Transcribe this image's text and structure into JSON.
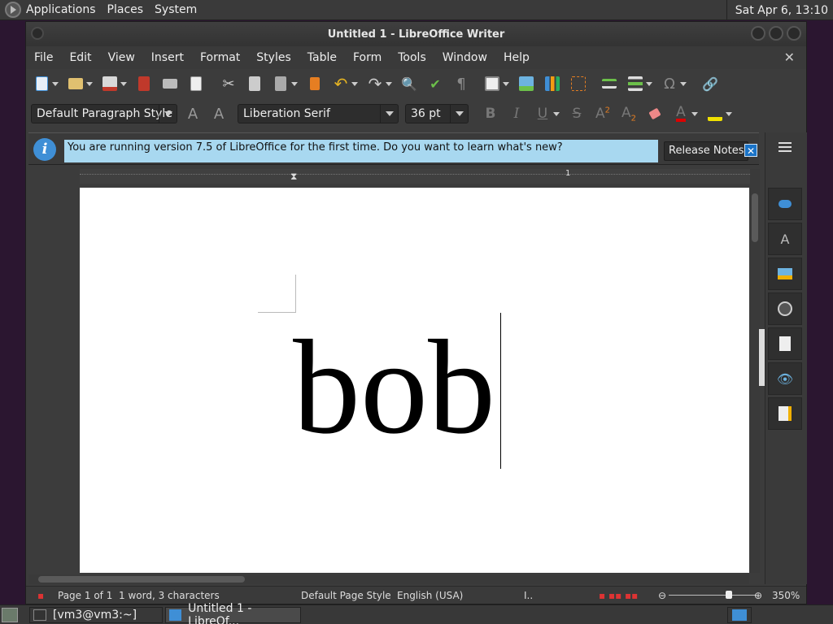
{
  "top_panel": {
    "menus": [
      "Applications",
      "Places",
      "System"
    ],
    "clock": "Sat Apr  6, 13:10"
  },
  "window": {
    "title": "Untitled 1 - LibreOffice Writer",
    "menubar": [
      "File",
      "Edit",
      "View",
      "Insert",
      "Format",
      "Styles",
      "Table",
      "Form",
      "Tools",
      "Window",
      "Help"
    ]
  },
  "format_bar": {
    "paragraph_style": "Default Paragraph Style",
    "font_name": "Liberation Serif",
    "font_size": "36 pt"
  },
  "infobar": {
    "message": "You are running version 7.5 of LibreOffice for the first time. Do you want to learn what's new?",
    "release_notes_label": "Release Notes"
  },
  "ruler": {
    "mark": "1"
  },
  "document": {
    "text": "bob"
  },
  "statusbar": {
    "page": "Page 1 of 1",
    "words": "1 word, 3 characters",
    "page_style": "Default Page Style",
    "language": "English (USA)",
    "zoom": "350%"
  },
  "taskbar": {
    "tasks": [
      "[vm3@vm3:~]",
      "Untitled 1 - LibreOf..."
    ]
  },
  "colors": {
    "accent": "#3f8fd6",
    "infobar_bg": "#a8d8f0",
    "desktop_bg": "#2b1630"
  }
}
